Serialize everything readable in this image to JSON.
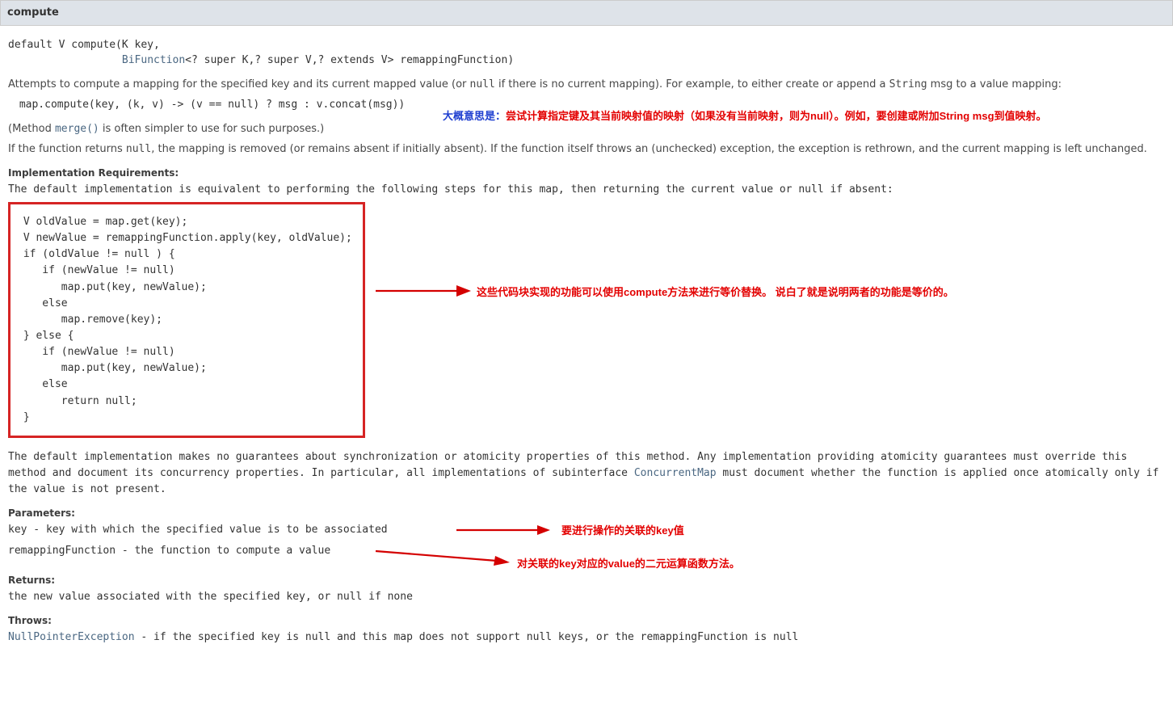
{
  "header": {
    "title": "compute"
  },
  "signature": {
    "line1_pre": "default V compute(K key,",
    "line2_indent": "                  ",
    "line2_link": "BiFunction",
    "line2_post": "<? super K,? super V,? extends V> remappingFunction)"
  },
  "desc": {
    "p1_a": "Attempts to compute a mapping for the specified key and its current mapped value (or ",
    "p1_code1": "null",
    "p1_b": " if there is no current mapping). For example, to either create or append a ",
    "p1_code2": "String",
    "p1_c": " msg to a value mapping:",
    "code_example": " map.compute(key, (k, v) -> (v == null) ? msg : v.concat(msg))",
    "p_merge_a": "(Method ",
    "p_merge_link": "merge()",
    "p_merge_b": " is often simpler to use for such purposes.)",
    "p2_a": "If the function returns ",
    "p2_code1": "null",
    "p2_b": ", the mapping is removed (or remains absent if initially absent). If the function itself throws an (unchecked) exception, the exception is rethrown, and the current mapping is left unchanged."
  },
  "impl": {
    "label": "Implementation Requirements:",
    "intro": "The default implementation is equivalent to performing the following steps for this map, then returning the current value or null if absent:",
    "codeblock": " V oldValue = map.get(key);\n V newValue = remappingFunction.apply(key, oldValue);\n if (oldValue != null ) {\n    if (newValue != null)\n       map.put(key, newValue);\n    else\n       map.remove(key);\n } else {\n    if (newValue != null)\n       map.put(key, newValue);\n    else\n       return null;\n }",
    "tail_a": "The default implementation makes no guarantees about synchronization or atomicity properties of this method. Any implementation providing atomicity guarantees must override this method and document its concurrency properties. In particular, all implementations of subinterface ",
    "tail_link": "ConcurrentMap",
    "tail_b": " must document whether the function is applied once atomically only if the value is not present."
  },
  "params": {
    "label": "Parameters:",
    "key": "key - key with which the specified value is to be associated",
    "remap": "remappingFunction - the function to compute a value"
  },
  "returns": {
    "label": "Returns:",
    "text": "the new value associated with the specified key, or null if none"
  },
  "throws": {
    "label": "Throws:",
    "link": "NullPointerException",
    "text": " - if the specified key is null and this map does not support null keys, or the remappingFunction is null"
  },
  "anno": {
    "a1_prefix": "大概意思是：",
    "a1_body": "尝试计算指定键及其当前映射值的映射（如果没有当前映射，则为null）。例如，要创建或附加String msg到值映射。",
    "a2": "这些代码块实现的功能可以使用compute方法来进行等价替换。 说白了就是说明两者的功能是等价的。",
    "a3": "要进行操作的关联的key值",
    "a4": "对关联的key对应的value的二元运算函数方法。"
  }
}
